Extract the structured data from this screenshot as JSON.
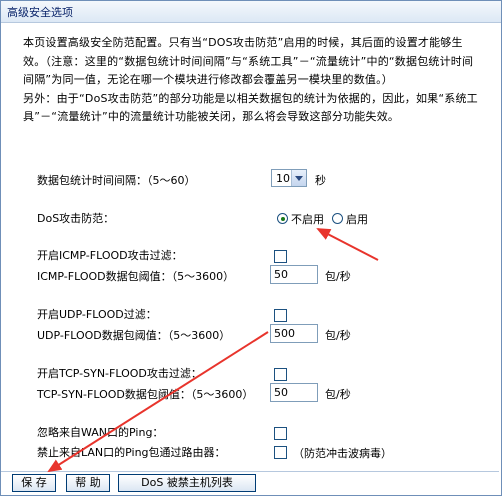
{
  "window": {
    "title": "高级安全选项"
  },
  "intro": {
    "line1": "本页设置高级安全防范配置。只有当“DOS攻击防范”启用的时候，其后面的设置才能够生效。（注意：这里的“数据包统计时间间隔”与“系统工具”－“流量统计”中的“数据包统计时间间隔”为同一值，无论在哪一个模块进行修改都会覆盖另一模块里的数值。）",
    "line2": "另外：由于“DoS攻击防范”的部分功能是以相关数据包的统计为依据的，因此，如果“系统工具”－“流量统计”中的流量统计功能被关闭，那么将会导致这部分功能失效。"
  },
  "form": {
    "interval_label": "数据包统计时间间隔：（5～60）",
    "interval_value": "10",
    "interval_unit": "秒",
    "dos_label": "DoS攻击防范：",
    "dos_options": [
      "不启用",
      "启用"
    ],
    "dos_selected": "不启用",
    "icmp_enable_label": "开启ICMP-FLOOD攻击过滤：",
    "icmp_threshold_label": "ICMP-FLOOD数据包阈值：（5～3600）",
    "icmp_threshold_value": "50",
    "udp_enable_label": "开启UDP-FLOOD过滤：",
    "udp_threshold_label": "UDP-FLOOD数据包阈值：（5～3600）",
    "udp_threshold_value": "500",
    "tcp_enable_label": "开启TCP-SYN-FLOOD攻击过滤：",
    "tcp_threshold_label": "TCP-SYN-FLOOD数据包阈值：（5～3600）",
    "tcp_threshold_value": "50",
    "rate_unit": "包/秒",
    "wan_ping_label": "忽略来自WAN口的Ping：",
    "lan_ping_label": "禁止来自LAN口的Ping包通过路由器：",
    "lan_ping_note": "（防范冲击波病毒）"
  },
  "buttons": {
    "save": "保 存",
    "help": "帮 助",
    "dos_list": "DoS 被禁主机列表"
  },
  "colors": {
    "annotation_arrow": "#e8342c",
    "border": "#6f8fb8"
  }
}
